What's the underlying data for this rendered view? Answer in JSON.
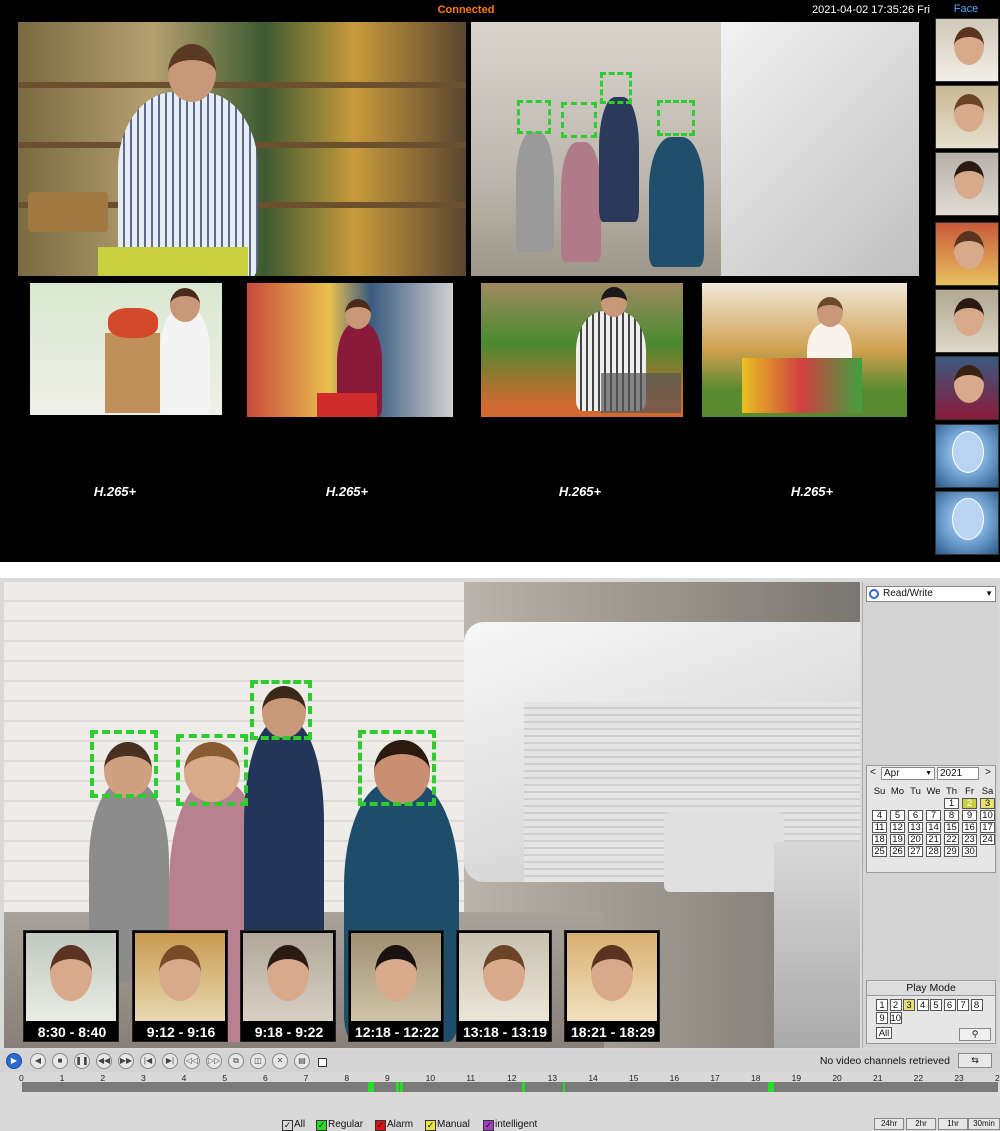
{
  "top": {
    "status": "Connected",
    "datetime": "2021-04-02 17:35:26 Fri",
    "face_panel_title": "Face",
    "codec_labels": [
      "H.265+",
      "H.265+",
      "H.265+",
      "H.265+"
    ]
  },
  "playback": {
    "stream_mode": "Read/Write",
    "calendar": {
      "month": "Apr",
      "year": "2021",
      "weekdays": [
        "Su",
        "Mo",
        "Tu",
        "We",
        "Th",
        "Fr",
        "Sa"
      ],
      "days": [
        "1",
        "2",
        "3",
        "4",
        "5",
        "6",
        "7",
        "8",
        "9",
        "10",
        "11",
        "12",
        "13",
        "14",
        "15",
        "16",
        "17",
        "18",
        "19",
        "20",
        "21",
        "22",
        "23",
        "24",
        "25",
        "26",
        "27",
        "28",
        "29",
        "30"
      ],
      "first_weekday_index": 4,
      "recorded_days": [
        "2",
        "3"
      ],
      "selected_day": "2"
    },
    "play_mode_title": "Play Mode",
    "channels": [
      "1",
      "2",
      "3",
      "4",
      "5",
      "6",
      "7",
      "8",
      "9",
      "10"
    ],
    "channels_all": "All",
    "selected_channel": "3",
    "face_events": [
      "8:30 - 8:40",
      "9:12 - 9:16",
      "9:18 - 9:22",
      "12:18 - 12:22",
      "13:18 - 13:19",
      "18:21 - 18:29"
    ],
    "status_message": "No video channels retrieved",
    "timeline_hours": [
      "0",
      "1",
      "2",
      "3",
      "4",
      "5",
      "6",
      "7",
      "8",
      "9",
      "10",
      "11",
      "12",
      "13",
      "14",
      "15",
      "16",
      "17",
      "18",
      "19",
      "20",
      "21",
      "22",
      "23",
      "24"
    ],
    "legend": {
      "all": "All",
      "regular": "Regular",
      "alarm": "Alarm",
      "manual": "Manual",
      "intelligent": "intelligent"
    },
    "zoom_buttons": [
      "24hr",
      "2hr",
      "1hr",
      "30min"
    ]
  },
  "colors": {
    "regular": "#22dd22",
    "alarm": "#dd1111",
    "manual": "#e8e840",
    "intelligent": "#a040c0",
    "status": "#ff7a1a",
    "face_box": "#2ecc2e"
  }
}
